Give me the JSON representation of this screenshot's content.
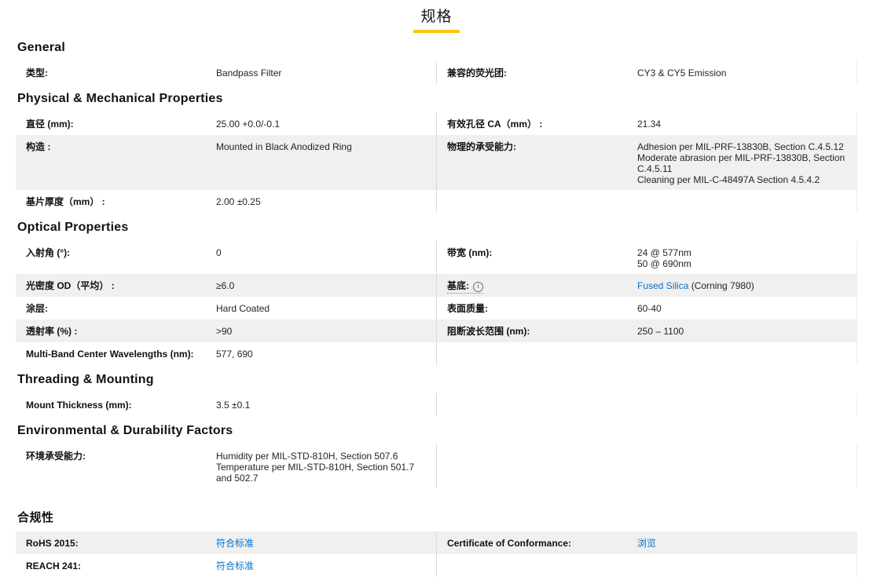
{
  "title": "规格",
  "theme": {
    "accent": "#ffc20e",
    "link": "#0072ce",
    "shade": "#f0f0f0"
  },
  "sections": [
    {
      "id": "general",
      "heading": "General",
      "lang": "en",
      "rows": [
        {
          "shade": false,
          "left": {
            "label": "类型:",
            "value": {
              "lines": [
                "Bandpass Filter"
              ]
            }
          },
          "right": {
            "label": "兼容的荧光团:",
            "value": {
              "lines": [
                "CY3 & CY5 Emission"
              ]
            }
          }
        }
      ]
    },
    {
      "id": "physical-mechanical",
      "heading": "Physical & Mechanical Properties",
      "lang": "en",
      "rows": [
        {
          "shade": false,
          "left": {
            "label": "直径 (mm):",
            "value": {
              "lines": [
                "25.00 +0.0/-0.1"
              ]
            }
          },
          "right": {
            "label": "有效孔径 CA（mm） :",
            "value": {
              "lines": [
                "21.34"
              ]
            }
          }
        },
        {
          "shade": true,
          "left": {
            "label": "构造 :",
            "value": {
              "lines": [
                "Mounted in Black Anodized Ring"
              ]
            }
          },
          "right": {
            "label": "物理的承受能力:",
            "value": {
              "lines": [
                "Adhesion per MIL-PRF-13830B, Section C.4.5.12",
                "Moderate abrasion per MIL-PRF-13830B, Section C.4.5.11",
                "Cleaning per MIL-C-48497A Section 4.5.4.2"
              ]
            }
          }
        },
        {
          "shade": false,
          "left": {
            "label": "基片厚度（mm） :",
            "value": {
              "lines": [
                "2.00 ±0.25"
              ]
            }
          },
          "right": null
        }
      ]
    },
    {
      "id": "optical",
      "heading": "Optical Properties",
      "lang": "en",
      "rows": [
        {
          "shade": false,
          "left": {
            "label": "入射角 (°):",
            "value": {
              "lines": [
                "0"
              ]
            }
          },
          "right": {
            "label": "带宽 (nm):",
            "value": {
              "lines": [
                "24 @ 577nm",
                "50 @ 690nm"
              ]
            }
          }
        },
        {
          "shade": true,
          "left": {
            "label": "光密度 OD（平均） :",
            "value": {
              "lines": [
                "≥6.0"
              ]
            }
          },
          "right": {
            "label": "基底:",
            "dotted": true,
            "icon": "info-circle-icon",
            "value": {
              "link": "Fused Silica",
              "text": " (Corning 7980)"
            }
          }
        },
        {
          "shade": false,
          "left": {
            "label": "涂层:",
            "value": {
              "lines": [
                "Hard Coated"
              ]
            }
          },
          "right": {
            "label": "表面质量:",
            "value": {
              "lines": [
                "60-40"
              ]
            }
          }
        },
        {
          "shade": true,
          "left": {
            "label": "透射率 (%) :",
            "value": {
              "lines": [
                ">90"
              ]
            }
          },
          "right": {
            "label": "阻断波长范围 (nm):",
            "value": {
              "lines": [
                "250 – 1100"
              ]
            }
          }
        },
        {
          "shade": false,
          "left": {
            "label": "Multi-Band Center Wavelengths (nm):",
            "value": {
              "lines": [
                "577, 690"
              ]
            }
          },
          "right": null
        }
      ]
    },
    {
      "id": "threading-mounting",
      "heading": "Threading & Mounting",
      "lang": "en",
      "rows": [
        {
          "shade": false,
          "left": {
            "label": "Mount Thickness (mm):",
            "value": {
              "lines": [
                "3.5 ±0.1"
              ]
            }
          },
          "right": null
        }
      ]
    },
    {
      "id": "environmental-durability",
      "heading": "Environmental & Durability Factors",
      "lang": "en",
      "rows": [
        {
          "shade": false,
          "left": {
            "label": "环境承受能力:",
            "value": {
              "lines": [
                "Humidity per MIL-STD-810H, Section 507.6",
                "Temperature per MIL-STD-810H, Section 501.7 and 502.7"
              ]
            }
          },
          "right": null
        }
      ]
    },
    {
      "id": "compliance",
      "heading": "合规性",
      "lang": "cn",
      "rows": [
        {
          "shade": true,
          "left": {
            "label": "RoHS 2015:",
            "value": {
              "link": "符合标准"
            }
          },
          "right": {
            "label": "Certificate of Conformance:",
            "value": {
              "link": "浏览"
            }
          }
        },
        {
          "shade": false,
          "left": {
            "label": "REACH 241:",
            "value": {
              "link": "符合标准"
            }
          },
          "right": null
        }
      ]
    }
  ]
}
